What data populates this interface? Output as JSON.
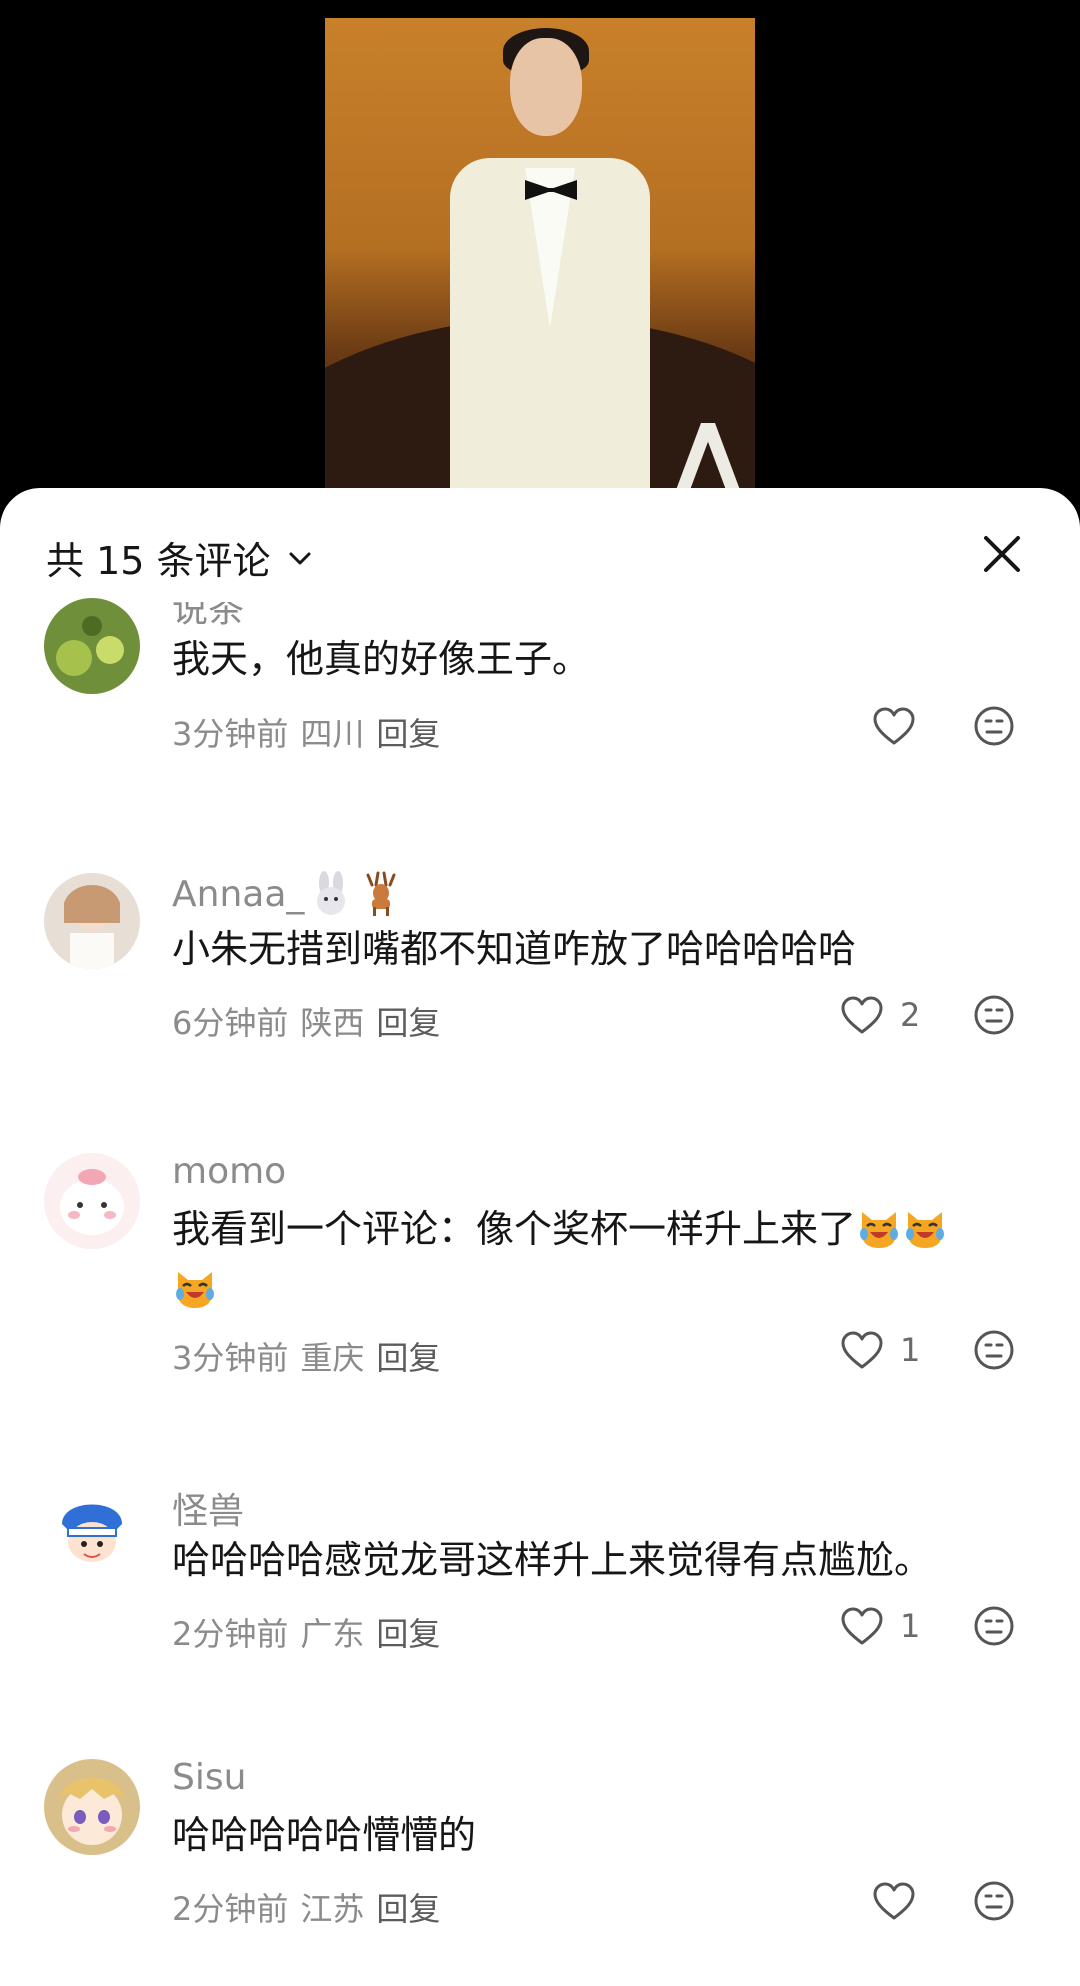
{
  "header": {
    "title": "共 15 条评论"
  },
  "comments": [
    {
      "username": "说茶",
      "text": "我天，他真的好像王子。",
      "time": "3分钟前",
      "location": "四川",
      "reply_label": "回复",
      "like_count": ""
    },
    {
      "username": "Annaa_",
      "username_emoji": [
        "rabbit-emoji",
        "deer-emoji"
      ],
      "text": "小朱无措到嘴都不知道咋放了哈哈哈哈哈",
      "time": "6分钟前",
      "location": "陕西",
      "reply_label": "回复",
      "like_count": "2"
    },
    {
      "username": "momo",
      "text": "我看到一个评论：像个奖杯一样升上来了",
      "text_emoji": [
        "laughing-cat-emoji",
        "laughing-cat-emoji",
        "laughing-cat-emoji"
      ],
      "time": "3分钟前",
      "location": "重庆",
      "reply_label": "回复",
      "like_count": "1"
    },
    {
      "username": "怪兽",
      "text": "哈哈哈哈感觉龙哥这样升上来觉得有点尴尬。",
      "time": "2分钟前",
      "location": "广东",
      "reply_label": "回复",
      "like_count": "1"
    },
    {
      "username": "Sisu",
      "text": "哈哈哈哈哈懵懵的",
      "time": "2分钟前",
      "location": "江苏",
      "reply_label": "回复",
      "like_count": ""
    }
  ],
  "colors": {
    "sheet_bg": "#ffffff",
    "text_primary": "#161616",
    "text_secondary": "#8b8b8b",
    "video_bg": "#000000"
  }
}
